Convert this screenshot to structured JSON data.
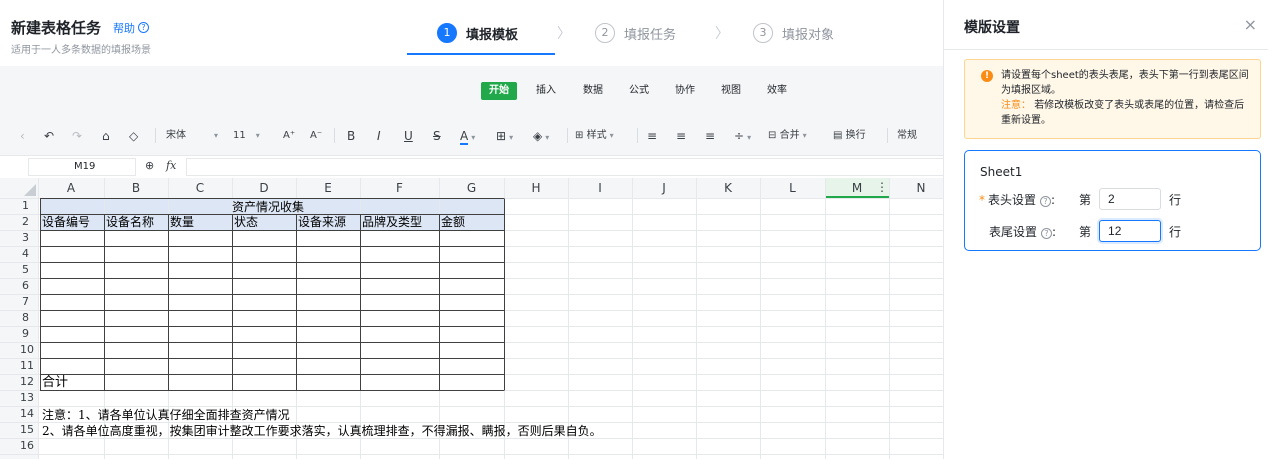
{
  "header": {
    "title": "新建表格任务",
    "help_label": "帮助",
    "help_icon": "?",
    "subtitle": "适用于一人多条数据的填报场景"
  },
  "steps": [
    {
      "num": "1",
      "label": "填报模板",
      "active": true
    },
    {
      "num": "2",
      "label": "填报任务",
      "active": false
    },
    {
      "num": "3",
      "label": "填报对象",
      "active": false
    }
  ],
  "menu_tabs": [
    "开始",
    "插入",
    "数据",
    "公式",
    "协作",
    "视图",
    "效率"
  ],
  "toolbar": {
    "font_name": "宋体",
    "font_size": "11",
    "grow_font": "A⁺",
    "shrink_font": "A⁻",
    "bold": "B",
    "italic": "I",
    "underline": "U",
    "strike": "S",
    "font_color": "A",
    "style_label": "样式",
    "merge_label": "合并",
    "wrap_label": "换行",
    "format_label": "常规"
  },
  "formula_bar": {
    "cell_ref": "M19",
    "fx": "fx"
  },
  "columns": [
    "A",
    "B",
    "C",
    "D",
    "E",
    "F",
    "G",
    "H",
    "I",
    "J",
    "K",
    "L",
    "M",
    "N"
  ],
  "rows": [
    "1",
    "2",
    "3",
    "4",
    "5",
    "6",
    "7",
    "8",
    "9",
    "10",
    "11",
    "12",
    "13",
    "14",
    "15",
    "16"
  ],
  "sheet": {
    "title": "资产情况收集",
    "headers": [
      "设备编号",
      "设备名称",
      "数量",
      "状态",
      "设备来源",
      "品牌及类型",
      "金额"
    ],
    "total_label": "合计",
    "note1": "注意：1、请各单位认真仔细全面排查资产情况",
    "note2": "2、请各单位高度重视，按集团审计整改工作要求落实，认真梳理排查，不得漏报、瞒报，否则后果自负。"
  },
  "panel": {
    "title": "模版设置",
    "close_icon": "×",
    "notice_line1": "请设置每个sheet的表头表尾，表头下第一行到表尾区间为填报区域。",
    "notice_warn": "注意：",
    "notice_line2": "若修改模板改变了表头或表尾的位置，请检查后重新设置。",
    "sheet_name": "Sheet1",
    "header_setting": {
      "label": "表头设置",
      "prefix": "第",
      "value": "2",
      "suffix": "行"
    },
    "footer_setting": {
      "label": "表尾设置",
      "prefix": "第",
      "value": "12",
      "suffix": "行"
    }
  },
  "colors": {
    "accent": "#1677ff",
    "active_tab": "#20a84a",
    "warning": "#fa8c16",
    "table_header_fill": "#dce6f5"
  }
}
